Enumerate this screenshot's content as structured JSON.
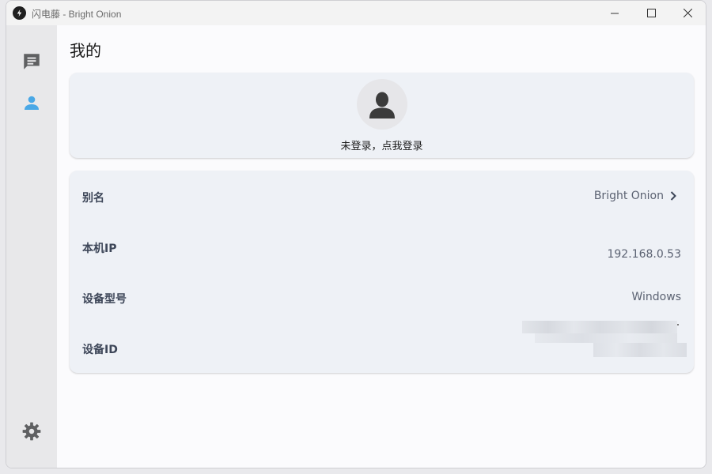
{
  "window": {
    "title": "闪电藤 - Bright Onion"
  },
  "page": {
    "title": "我的"
  },
  "profile": {
    "login_text": "未登录，点我登录"
  },
  "info": {
    "alias_label": "别名",
    "alias_value": "Bright Onion",
    "ip_label": "本机IP",
    "ip_value": "192.168.0.53",
    "model_label": "设备型号",
    "model_value": "Windows",
    "id_label": "设备ID"
  },
  "icons": {
    "app": "lightning-icon",
    "chat": "chat-icon",
    "user": "user-icon",
    "settings": "gear-icon",
    "avatar": "person-silhouette-icon",
    "chevron": "chevron-right-icon"
  },
  "colors": {
    "accent": "#4aa8e6",
    "card": "#eef1f6",
    "sidebar": "#e8e8ea"
  }
}
